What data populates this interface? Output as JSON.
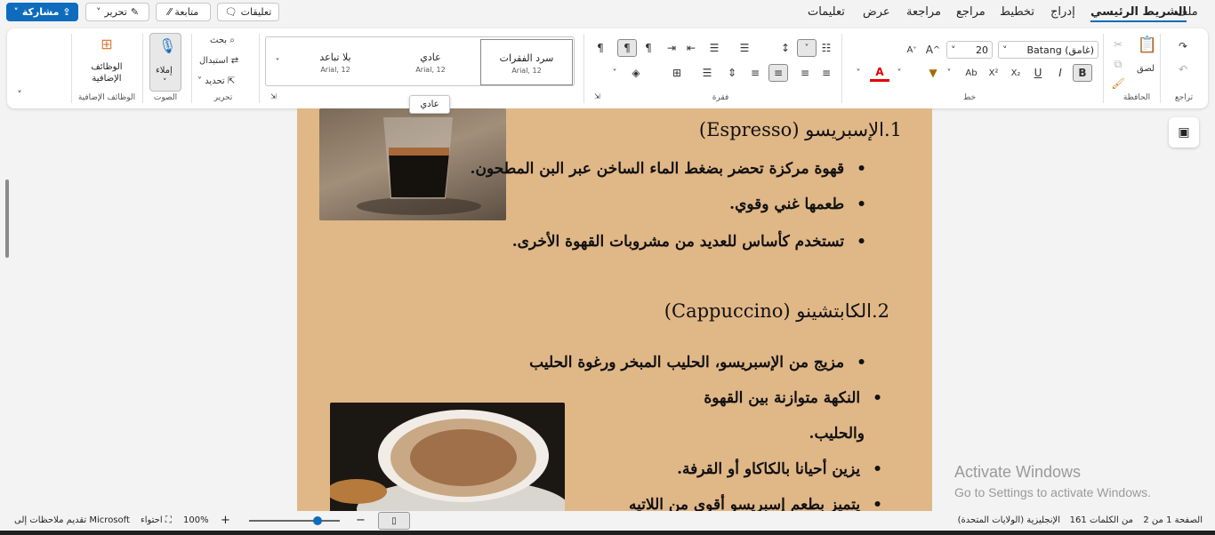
{
  "menu": {
    "tabs": [
      "ملف",
      "الشريط الرئيسي",
      "إدراج",
      "تخطيط",
      "مراجع",
      "مراجعة",
      "عرض",
      "تعليمات"
    ],
    "active_tab": "الشريط الرئيسي"
  },
  "top_actions": {
    "comments": "تعليقات",
    "follow": "متابعة",
    "edit": "تحرير",
    "share": "مشاركة"
  },
  "ribbon": {
    "undo_group": "تراجع",
    "clipboard": {
      "paste": "لصق",
      "label": "الحافظة"
    },
    "font": {
      "name": "Batang (غامق)",
      "size": "20",
      "label": "خط"
    },
    "paragraph_label": "فقرة",
    "styles": [
      {
        "name": "سرد الفقرات",
        "font": "Arial, 12"
      },
      {
        "name": "عادي",
        "font": "Arial, 12"
      },
      {
        "name": "بلا تباعد",
        "font": "Arial, 12"
      }
    ],
    "editing": {
      "find": "بحث",
      "replace": "استبدال",
      "select": "تحديد",
      "label": "تحرير"
    },
    "voice": {
      "dictate": "إملاء",
      "label": "الصوت"
    },
    "addins": {
      "button": "الوظائف الإضافية",
      "label": "الوظائف الإضافية"
    },
    "tooltip": "عادي"
  },
  "document": {
    "heading1": "1.الإسبريسو (Espresso)",
    "bullets1": [
      "قهوة مركزة تحضر بضغط الماء الساخن عبر البن المطحون.",
      "طعمها غني وقوي.",
      "تستخدم كأساس للعديد من مشروبات القهوة الأخرى."
    ],
    "heading2": "2.الكابتشينو (Cappuccino)",
    "bullets2": [
      "مزيج من الإسبريسو، الحليب المبخر ورغوة الحليب",
      "النكهة متوازنة بين القهوة",
      "يزين أحيانا بالكاكاو أو القرفة.",
      "يتميز بطعم إسبريسو أقوى من اللاتيه"
    ],
    "bullet2_continuation": "والحليب."
  },
  "status": {
    "page": "الصفحة 1 من 2",
    "words": "161 من الكلمات",
    "language": "الإنجليزية (الولايات المتحدة)",
    "zoom": "100%",
    "fit": "احتواء",
    "feedback": "تقديم ملاحظات إلى Microsoft",
    "zoom_level": 0.75
  },
  "watermark": {
    "line1": "Activate Windows",
    "line2": "Go to Settings to activate Windows."
  },
  "colors": {
    "accent": "#0f6cbd",
    "page": "#e0b787",
    "font_color": "#e00000"
  }
}
